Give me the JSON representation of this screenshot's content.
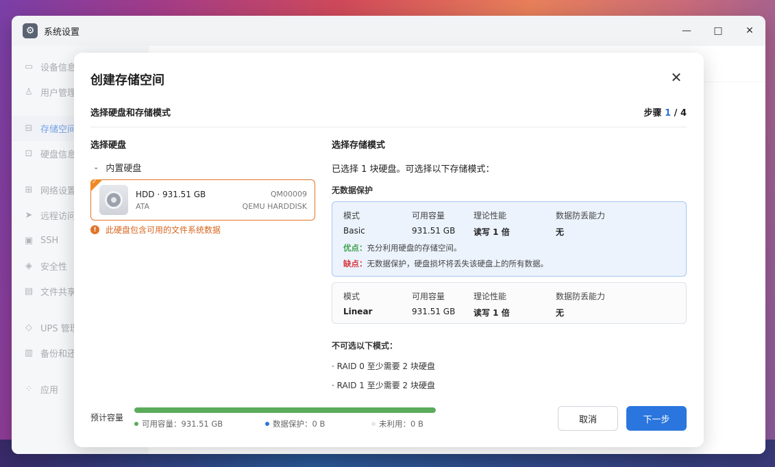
{
  "window": {
    "title": "系统设置",
    "controls": [
      "—",
      "□",
      "✕"
    ]
  },
  "sidebar": {
    "items": [
      {
        "label": "设备信息",
        "icon": "monitor-icon"
      },
      {
        "label": "用户管理",
        "icon": "user-icon"
      },
      {
        "label": "存储空间",
        "icon": "storage-icon",
        "active": true
      },
      {
        "label": "硬盘信息",
        "icon": "disk-icon"
      },
      {
        "label": "网络设置",
        "icon": "network-icon"
      },
      {
        "label": "远程访问",
        "icon": "send-icon"
      },
      {
        "label": "SSH",
        "icon": "terminal-icon"
      },
      {
        "label": "安全性",
        "icon": "shield-icon"
      },
      {
        "label": "文件共享",
        "icon": "file-icon"
      },
      {
        "label": "UPS 管理",
        "icon": "ups-icon"
      },
      {
        "label": "备份和还原",
        "icon": "backup-icon"
      },
      {
        "label": "应用",
        "icon": "apps-icon"
      }
    ]
  },
  "dialog": {
    "title": "创建存储空间",
    "close": "✕",
    "subtitle": "选择硬盘和存储模式",
    "step_label": "步骤",
    "step_current": "1",
    "step_total": "/ 4",
    "left": {
      "title": "选择硬盘",
      "group": "内置硬盘",
      "disk": {
        "name": "HDD · 931.51 GB",
        "interface": "ATA",
        "serial": "QM00009",
        "model": "QEMU HARDDISK"
      },
      "warning": "此硬盘包含可用的文件系统数据"
    },
    "right": {
      "title": "选择存储模式",
      "info": "已选择 1 块硬盘。可选择以下存储模式：",
      "group_label": "无数据保护",
      "headers": [
        "模式",
        "可用容量",
        "理论性能",
        "数据防丢能力"
      ],
      "modes": [
        {
          "mode": "Basic",
          "capacity": "931.51 GB",
          "performance": "读写 1 倍",
          "protection": "无",
          "pro_label": "优点：",
          "pro": "充分利用硬盘的存储空间。",
          "con_label": "缺点：",
          "con": "无数据保护，硬盘损坏将丢失该硬盘上的所有数据。"
        },
        {
          "mode": "Linear",
          "capacity": "931.51 GB",
          "performance": "读写 1 倍",
          "protection": "无"
        }
      ],
      "unavailable_title": "不可选以下模式：",
      "unavailable": [
        "· RAID 0   至少需要 2 块硬盘",
        "· RAID 1   至少需要 2 块硬盘"
      ]
    },
    "footer": {
      "capacity_label": "预计容量",
      "usage_fraction": 1.0,
      "legend_available": "可用容量：931.51 GB",
      "legend_protection": "数据保护：0 B",
      "legend_unused": "未利用：0 B",
      "cancel": "取消",
      "next": "下一步"
    }
  },
  "colors": {
    "accent": "#2a76de",
    "warning": "#e0742a",
    "pro": "#3ea24a",
    "con": "#d9363e",
    "bar_available": "#5aab5a",
    "bar_protection": "#2a76de",
    "bar_unused": "#e8eaed"
  }
}
